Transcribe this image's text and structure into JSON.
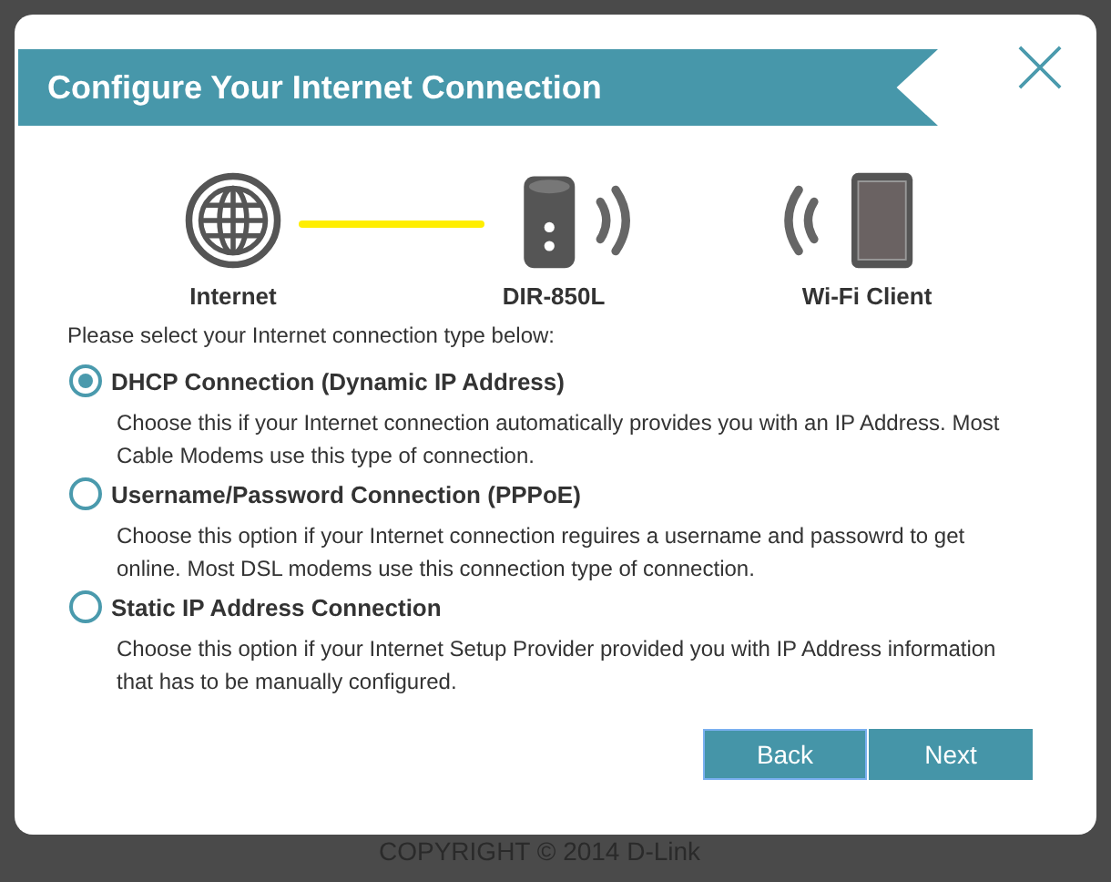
{
  "dialog": {
    "title": "Configure Your Internet Connection"
  },
  "diagram": [
    {
      "kind": "globe",
      "label": "Internet"
    },
    {
      "kind": "router",
      "label": "DIR-850L"
    },
    {
      "kind": "client",
      "label": "Wi-Fi Client"
    }
  ],
  "prompt": "Please select your Internet connection type below:",
  "options": [
    {
      "label": "DHCP Connection (Dynamic IP Address)",
      "description": "Choose this if your Internet connection automatically provides you with an IP Address. Most Cable Modems use this type of connection.",
      "selected": true
    },
    {
      "label": "Username/Password Connection (PPPoE)",
      "description": "Choose this option if your Internet connection reguires a username and passowrd to get online. Most DSL modems use this connection type of connection.",
      "selected": false
    },
    {
      "label": "Static IP Address Connection",
      "description": "Choose this option if your Internet Setup Provider provided you with IP Address information that has to be manually configured.",
      "selected": false
    }
  ],
  "buttons": [
    "Back",
    "Next"
  ],
  "footer": "COPYRIGHT © 2014 D-Link"
}
